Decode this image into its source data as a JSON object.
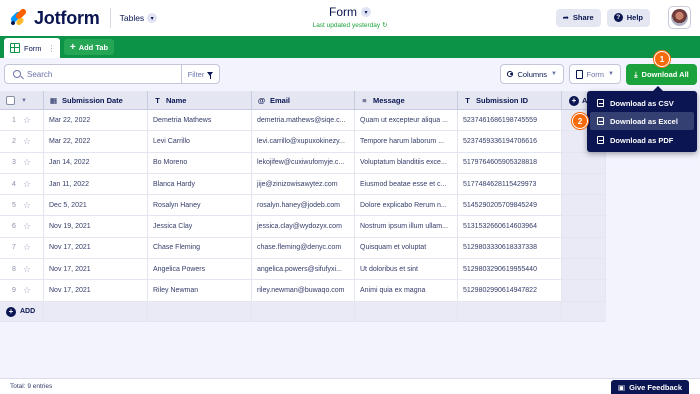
{
  "app": {
    "brand": "Jotform",
    "section": "Tables",
    "form_title": "Form",
    "last_updated": "Last updated yesterday",
    "share_label": "Share",
    "help_label": "Help"
  },
  "tabs": {
    "active_tab": "Form",
    "add_tab_label": "Add Tab"
  },
  "toolbar": {
    "search_placeholder": "Search",
    "filter_label": "Filter",
    "columns_label": "Columns",
    "form_label": "Form",
    "download_all_label": "Download All"
  },
  "table": {
    "columns": [
      "Submission Date",
      "Name",
      "Email",
      "Message",
      "Submission ID"
    ],
    "add_column_label": "A",
    "add_row_label": "ADD",
    "rows": [
      {
        "n": "1",
        "date": "Mar 22, 2022",
        "name": "Demetria Mathews",
        "email": "demetria.mathews@siqe.c...",
        "message": "Quam ut excepteur aliqua ...",
        "id": "5237461686198745559"
      },
      {
        "n": "2",
        "date": "Mar 22, 2022",
        "name": "Levi Carrillo",
        "email": "levi.carrillo@xupuxokinezy...",
        "message": "Tempore harum laborum ...",
        "id": "5237459336194706616"
      },
      {
        "n": "3",
        "date": "Jan 14, 2022",
        "name": "Bo Moreno",
        "email": "lekojifew@cuxiwufomyje.c...",
        "message": "Voluptatum blanditiis exce...",
        "id": "5179764605905328818"
      },
      {
        "n": "4",
        "date": "Jan 11, 2022",
        "name": "Blanca Hardy",
        "email": "jije@zinizowisawytez.com",
        "message": "Eiusmod beatae esse et c...",
        "id": "5177484628115429973"
      },
      {
        "n": "5",
        "date": "Dec 5, 2021",
        "name": "Rosalyn Haney",
        "email": "rosalyn.haney@jodeb.com",
        "message": "Dolore explicabo Rerum n...",
        "id": "5145290205709845249"
      },
      {
        "n": "6",
        "date": "Nov 19, 2021",
        "name": "Jessica Clay",
        "email": "jessica.clay@wydozyx.com",
        "message": "Nostrum ipsum illum ullam...",
        "id": "5131532660614603964"
      },
      {
        "n": "7",
        "date": "Nov 17, 2021",
        "name": "Chase Fleming",
        "email": "chase.fleming@denyc.com",
        "message": "Quisquam et voluptat",
        "id": "5129803330618337338"
      },
      {
        "n": "8",
        "date": "Nov 17, 2021",
        "name": "Angelica Powers",
        "email": "angelica.powers@sifufyxi...",
        "message": "Ut doloribus et sint",
        "id": "5129803290619955440"
      },
      {
        "n": "9",
        "date": "Nov 17, 2021",
        "name": "Riley Newman",
        "email": "riley.newman@buwaqo.com",
        "message": "Animi quia ex magna",
        "id": "5129802990614947822"
      }
    ]
  },
  "download_menu": {
    "items": [
      "Download as CSV",
      "Download as Excel",
      "Download as PDF"
    ],
    "highlighted": "Download as Excel"
  },
  "steps": [
    "1",
    "2"
  ],
  "footer": {
    "total": "Total: 9 entries",
    "feedback_label": "Give Feedback"
  },
  "colors": {
    "brand_green": "#0d9348",
    "navy": "#0a1551",
    "step_orange": "#f56a0c"
  }
}
